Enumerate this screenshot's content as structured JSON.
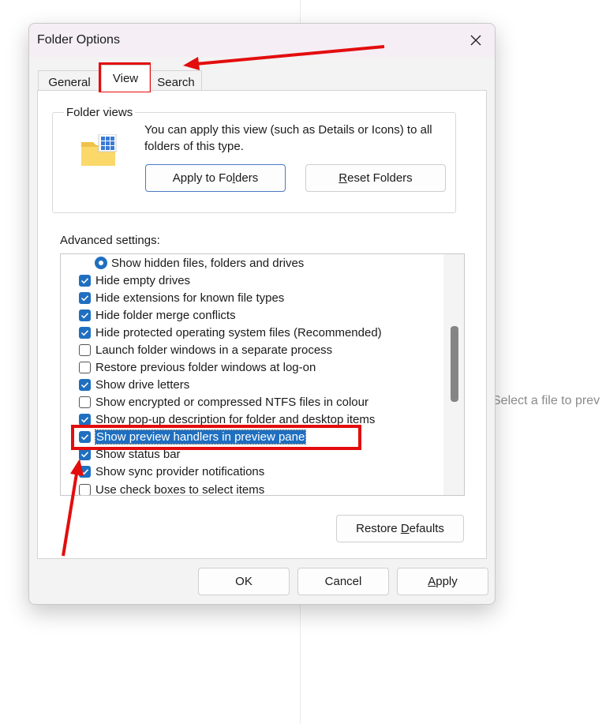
{
  "background": {
    "preview_text": "Select a file to prev"
  },
  "dialog": {
    "title": "Folder Options",
    "tabs": [
      {
        "label": "General"
      },
      {
        "label": "View",
        "selected": true
      },
      {
        "label": "Search"
      }
    ],
    "folder_views": {
      "label": "Folder views",
      "description": "You can apply this view (such as Details or Icons) to all folders of this type.",
      "apply_button": {
        "before": "Apply to Fo",
        "accel": "l",
        "after": "ders"
      },
      "reset_button": {
        "accel": "R",
        "after": "eset Folders"
      }
    },
    "advanced": {
      "label": "Advanced settings:",
      "items": [
        {
          "label": "Show hidden files, folders and drives",
          "type": "radio",
          "checked": true
        },
        {
          "label": "Hide empty drives",
          "type": "checkbox",
          "checked": true
        },
        {
          "label": "Hide extensions for known file types",
          "type": "checkbox",
          "checked": true
        },
        {
          "label": "Hide folder merge conflicts",
          "type": "checkbox",
          "checked": true
        },
        {
          "label": "Hide protected operating system files (Recommended)",
          "type": "checkbox",
          "checked": true
        },
        {
          "label": "Launch folder windows in a separate process",
          "type": "checkbox",
          "checked": false
        },
        {
          "label": "Restore previous folder windows at log-on",
          "type": "checkbox",
          "checked": false
        },
        {
          "label": "Show drive letters",
          "type": "checkbox",
          "checked": true
        },
        {
          "label": "Show encrypted or compressed NTFS files in colour",
          "type": "checkbox",
          "checked": false
        },
        {
          "label": "Show pop-up description for folder and desktop items",
          "type": "checkbox",
          "checked": true
        },
        {
          "label": "Show preview handlers in preview pane",
          "type": "checkbox",
          "checked": true,
          "selected": true
        },
        {
          "label": "Show status bar",
          "type": "checkbox",
          "checked": true
        },
        {
          "label": "Show sync provider notifications",
          "type": "checkbox",
          "checked": true
        },
        {
          "label": "Use check boxes to select items",
          "type": "checkbox",
          "checked": false
        }
      ]
    },
    "restore_defaults": {
      "before": "Restore ",
      "accel": "D",
      "after": "efaults"
    },
    "ok_label": "OK",
    "cancel_label": "Cancel",
    "apply": {
      "accel": "A",
      "after": "pply"
    }
  },
  "colors": {
    "accent": "#1f6fc0",
    "annotation": "#e30d0d",
    "titlebar": "#f5eef5"
  },
  "icons": {
    "folder": "folder-view-icon",
    "close": "close-icon",
    "check": "checkmark-icon"
  }
}
